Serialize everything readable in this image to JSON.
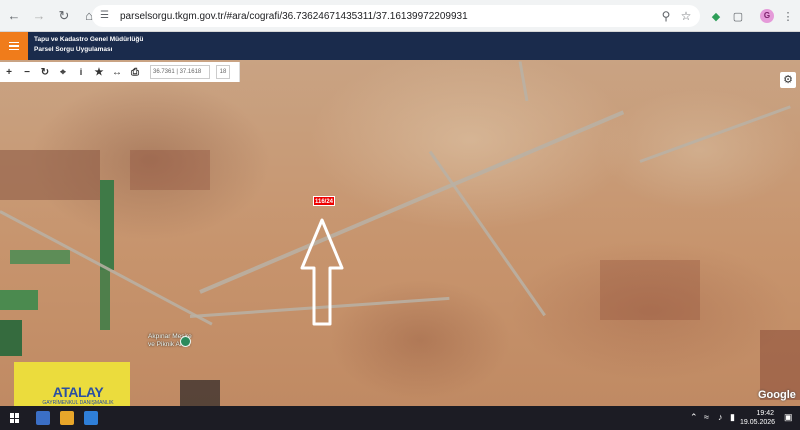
{
  "browser": {
    "url": "parselsorgu.tkgm.gov.tr/#ara/cografi/36.73624671435311/37.16139972209931",
    "icons": {
      "back": "arrow-left-icon",
      "forward": "arrow-right-icon",
      "reload": "reload-icon",
      "home": "home-icon",
      "site_info": "tune-icon",
      "location": "location-pin-icon",
      "bookmark": "star-icon",
      "extension": "puzzle-icon",
      "menu": "kebab-menu-icon"
    },
    "profile_initial": "G"
  },
  "app": {
    "title_line1": "Tapu ve Kadastro Genel Müdürlüğü",
    "title_line2": "Parsel Sorgu Uygulaması",
    "accent_color": "#f07c1b",
    "header_color": "#1a2b4c"
  },
  "toolbar": {
    "zoom_in": "+",
    "zoom_out": "−",
    "coordinates": "36.7361 | 37.1618",
    "zoom_level": "18",
    "tools": [
      "zoom-in-icon",
      "zoom-out-icon",
      "refresh-icon",
      "locate-icon",
      "info-icon",
      "favorite-icon",
      "measure-icon",
      "print-icon"
    ]
  },
  "map": {
    "parcel_label": "116/24",
    "poi_name_line1": "Akpınar Mesire",
    "poi_name_line2": "ve Piknik Alanı",
    "watermark_name": "ATALAY",
    "watermark_sub": "GAYRİMENKUL DANIŞMANLIK",
    "attribution": "Google"
  },
  "taskbar": {
    "time": "19:42",
    "date": "19.05.2026"
  }
}
